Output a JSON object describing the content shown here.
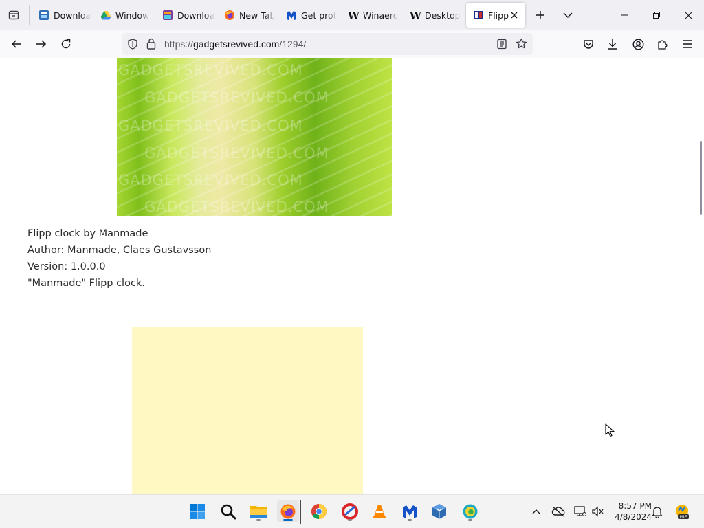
{
  "browser": {
    "tabs": [
      {
        "title": "Downloa",
        "favicon": "news-favicon",
        "color": "#2f6fb5"
      },
      {
        "title": "Window",
        "favicon": "drive-favicon",
        "color": "#1fa463"
      },
      {
        "title": "Downloa",
        "favicon": "gallery-favicon",
        "color": "#7b3fa0"
      },
      {
        "title": "New Tab",
        "favicon": "firefox-favicon",
        "color": "#ff6d1a"
      },
      {
        "title": "Get prot",
        "favicon": "malwarebytes-favicon",
        "color": "#1452c8"
      },
      {
        "title": "Winaero",
        "favicon": "winaero-favicon",
        "color": "#111111"
      },
      {
        "title": "Desktop",
        "favicon": "winaero-favicon",
        "color": "#111111"
      },
      {
        "title": "Flipp",
        "favicon": "gadgets-favicon",
        "color": "#1b2f8a",
        "active": true
      }
    ],
    "url": {
      "prefix": "https://",
      "domain": "gadgetsrevived.com",
      "path": "/1294/"
    }
  },
  "page": {
    "image_watermark": [
      "GADGETSREVIVED.COM",
      "GADGETSREVIVED.COM",
      "GADGETSREVIVED.COM",
      "GADGETSREVIVED.COM",
      "GADGETSREVIVED.COM",
      "GADGETSREVIVED.COM"
    ],
    "description": {
      "name": "Flipp clock by Manmade",
      "author": "Author: Manmade, Claes Gustavsson",
      "version": "Version: 1.0.0.0",
      "summary": "\"Manmade\" Flipp clock."
    }
  },
  "taskbar": {
    "apps": [
      "start-icon",
      "search-icon",
      "file-explorer-icon",
      "firefox-icon",
      "chrome-icon",
      "ccleaner-icon",
      "vlc-icon",
      "malwarebytes-icon",
      "virtualbox-icon",
      "edge-canary-icon"
    ],
    "clock": {
      "time": "8:57 PM",
      "date": "4/8/2024"
    }
  },
  "colors": {
    "accent": "#0067c0",
    "yellow_image": "#fff8c2",
    "leaf_green": "#8fcb25"
  }
}
